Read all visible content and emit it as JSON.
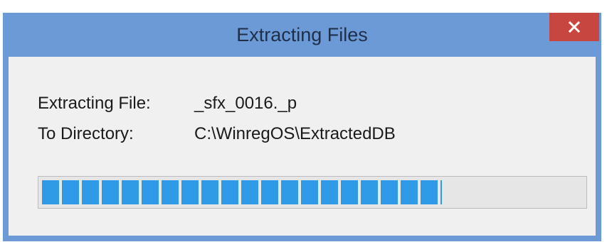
{
  "window": {
    "title": "Extracting Files",
    "close_icon": "close-icon"
  },
  "details": {
    "file_label": "Extracting File:",
    "file_value": "_sfx_0016._p",
    "dir_label": "To Directory:",
    "dir_value": "C:\\WinregOS\\ExtractedDB"
  },
  "progress": {
    "percent": 74
  },
  "colors": {
    "accent": "#2f9be8",
    "titlebar": "#6b9ad6",
    "close_button": "#c7463f"
  }
}
